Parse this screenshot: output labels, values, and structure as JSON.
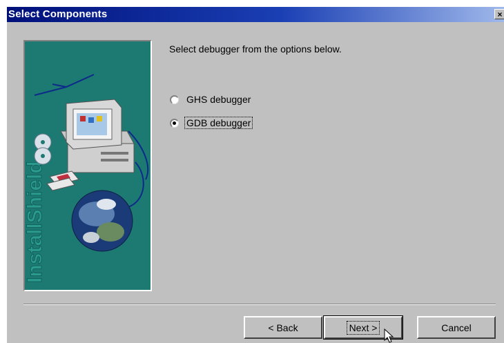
{
  "window": {
    "title": "Select Components",
    "close_label": "×"
  },
  "banner": {
    "vertical_text": "InstallShield"
  },
  "prompt": "Select debugger from the options below.",
  "options": [
    {
      "label": "GHS debugger",
      "selected": false
    },
    {
      "label": "GDB debugger",
      "selected": true
    }
  ],
  "buttons": {
    "back": "< Back",
    "next": "Next >",
    "cancel": "Cancel"
  },
  "colors": {
    "titlebar_start": "#00107a",
    "dialog_bg": "#c0c0c0",
    "banner_bg": "#1d7a72"
  }
}
